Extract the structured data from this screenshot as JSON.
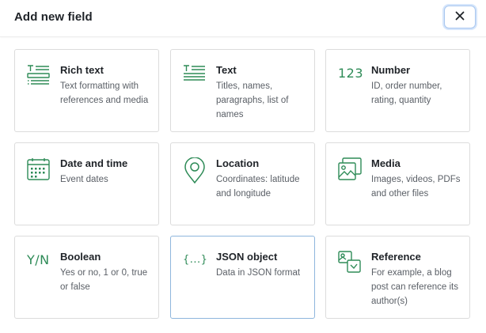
{
  "dialog": {
    "title": "Add new field",
    "close_icon": "close-icon"
  },
  "field_types": [
    {
      "name": "Rich text",
      "description": "Text formatting with references and media",
      "icon": "rich-text-icon"
    },
    {
      "name": "Text",
      "description": "Titles, names, paragraphs, list of names",
      "icon": "text-icon"
    },
    {
      "name": "Number",
      "description": "ID, order number, rating, quantity",
      "icon": "number-icon",
      "icon_text": "123"
    },
    {
      "name": "Date and time",
      "description": "Event dates",
      "icon": "calendar-icon"
    },
    {
      "name": "Location",
      "description": "Coordinates: latitude and longitude",
      "icon": "location-pin-icon"
    },
    {
      "name": "Media",
      "description": "Images, videos, PDFs and other files",
      "icon": "media-icon"
    },
    {
      "name": "Boolean",
      "description": "Yes or no, 1 or 0, true or false",
      "icon": "boolean-icon",
      "icon_text": "Y/N"
    },
    {
      "name": "JSON object",
      "description": "Data in JSON format",
      "icon": "json-icon",
      "icon_text": "{...}",
      "selected": true
    },
    {
      "name": "Reference",
      "description": "For example, a blog post can reference its author(s)",
      "icon": "reference-icon"
    }
  ],
  "colors": {
    "icon_green": "#2e8b57",
    "selected_border": "#8fb6dd",
    "close_focus": "#a9c7ef"
  }
}
